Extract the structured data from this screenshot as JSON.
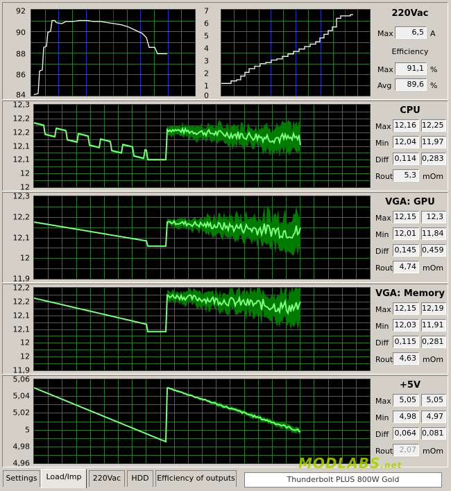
{
  "top": {
    "left_chart": {
      "ticks": [
        "92",
        "90",
        "88",
        "86",
        "84"
      ],
      "ymin": 84,
      "ymax": 92
    },
    "right_chart": {
      "ticks": [
        "7",
        "6",
        "5",
        "4",
        "3",
        "2",
        "1",
        "0"
      ],
      "ymin": 0,
      "ymax": 7
    },
    "panel": {
      "title": "220Vac",
      "max_label": "Max",
      "max_value": "6,5",
      "max_unit": "A",
      "efficiency_label": "Efficiency",
      "eff_max_label": "Max",
      "eff_max_value": "91,1",
      "eff_max_unit": "%",
      "eff_avg_label": "Avg",
      "eff_avg_value": "89,6",
      "eff_avg_unit": "%"
    }
  },
  "rails": [
    {
      "title": "CPU",
      "ticks": [
        "12,3",
        "12,2",
        "12,2",
        "12,1",
        "12,1",
        "12",
        "12"
      ],
      "ymin": 11.95,
      "ymax": 12.28,
      "max_label": "Max",
      "max_a": "12,16",
      "max_b": "12,25",
      "min_label": "Min",
      "min_a": "12,04",
      "min_b": "11,97",
      "diff_label": "Diff",
      "diff_a": "0,114",
      "diff_b": "0,283",
      "rout_label": "Rout",
      "rout_value": "5,3",
      "rout_unit": "mOm",
      "rout_dim": false
    },
    {
      "title": "VGA: GPU",
      "ticks": [
        "12,3",
        "12,2",
        "12,1",
        "12",
        "11,9"
      ],
      "ymin": 11.82,
      "ymax": 12.3,
      "max_label": "Max",
      "max_a": "12,15",
      "max_b": "12,3",
      "min_label": "Min",
      "min_a": "12,01",
      "min_b": "11,84",
      "diff_label": "Diff",
      "diff_a": "0,145",
      "diff_b": "0,459",
      "rout_label": "Rout",
      "rout_value": "4,74",
      "rout_unit": "mOm",
      "rout_dim": false
    },
    {
      "title": "VGA: Memory",
      "ticks": [
        "12,2",
        "12,2",
        "12,1",
        "12,1",
        "12",
        "12",
        "11,9"
      ],
      "ymin": 11.9,
      "ymax": 12.22,
      "max_label": "Max",
      "max_a": "12,15",
      "max_b": "12,19",
      "min_label": "Min",
      "min_a": "12,03",
      "min_b": "11,91",
      "diff_label": "Diff",
      "diff_a": "0,115",
      "diff_b": "0,281",
      "rout_label": "Rout",
      "rout_value": "4,63",
      "rout_unit": "mOm",
      "rout_dim": false
    },
    {
      "title": "+5V",
      "ticks": [
        "5,06",
        "5,04",
        "5,02",
        "5",
        "4,98",
        "4,96"
      ],
      "ymin": 4.96,
      "ymax": 5.06,
      "max_label": "Max",
      "max_a": "5,05",
      "max_b": "5,05",
      "min_label": "Min",
      "min_a": "4,98",
      "min_b": "4,97",
      "diff_label": "Diff",
      "diff_a": "0,064",
      "diff_b": "0,081",
      "rout_label": "Rout",
      "rout_value": "2,07",
      "rout_unit": "mOm",
      "rout_dim": true
    }
  ],
  "tabs": [
    {
      "label": "Settings",
      "active": false
    },
    {
      "label": "Load/Imp",
      "active": true
    },
    {
      "label": "220Vac",
      "active": false
    },
    {
      "label": "HDD",
      "active": false
    },
    {
      "label": "Efficiency of outputs",
      "active": false
    }
  ],
  "status": "Thunderbolt PLUS 800W Gold",
  "logo": {
    "text": "MODLABS",
    "suffix": ".net"
  },
  "colors": {
    "plot_bg": "#000000",
    "grid_green": "#2f7a2f",
    "grid_blue": "#2030c0",
    "band": "#007a00",
    "line": "#7dff7d",
    "white_line": "#ffffff"
  }
}
